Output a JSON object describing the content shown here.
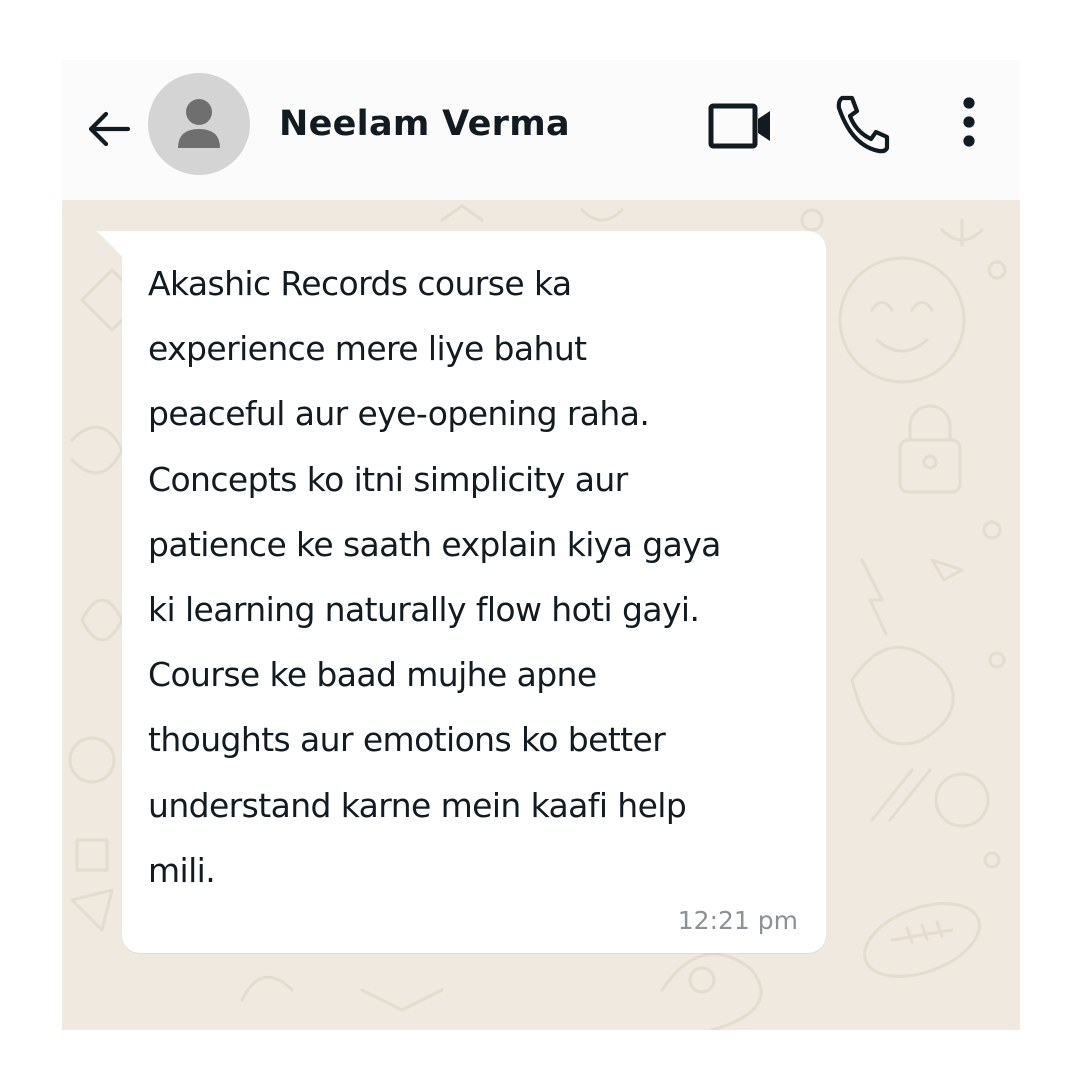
{
  "header": {
    "back_icon": "arrow-left-icon",
    "avatar_icon": "person-silhouette-icon",
    "contact_name": "Neelam Verma",
    "video_icon": "video-camera-icon",
    "call_icon": "phone-icon",
    "menu_icon": "vertical-dots-icon"
  },
  "message": {
    "text": "Akashic Records course ka\nexperience mere liye bahut\npeaceful aur eye-opening raha.\nConcepts ko itni simplicity aur\npatience ke saath explain kiya gaya\nki learning naturally flow hoti gayi.\nCourse ke baad mujhe apne\nthoughts aur emotions ko better\nunderstand karne mein kaafi help\nmili.",
    "time": "12:21 pm"
  },
  "colors": {
    "header_bg": "#fbfbfb",
    "chat_bg": "#efe9df",
    "bubble_bg": "#ffffff",
    "text": "#111b21",
    "timestamp": "#8a9298",
    "avatar_bg": "#d4d4d4"
  }
}
